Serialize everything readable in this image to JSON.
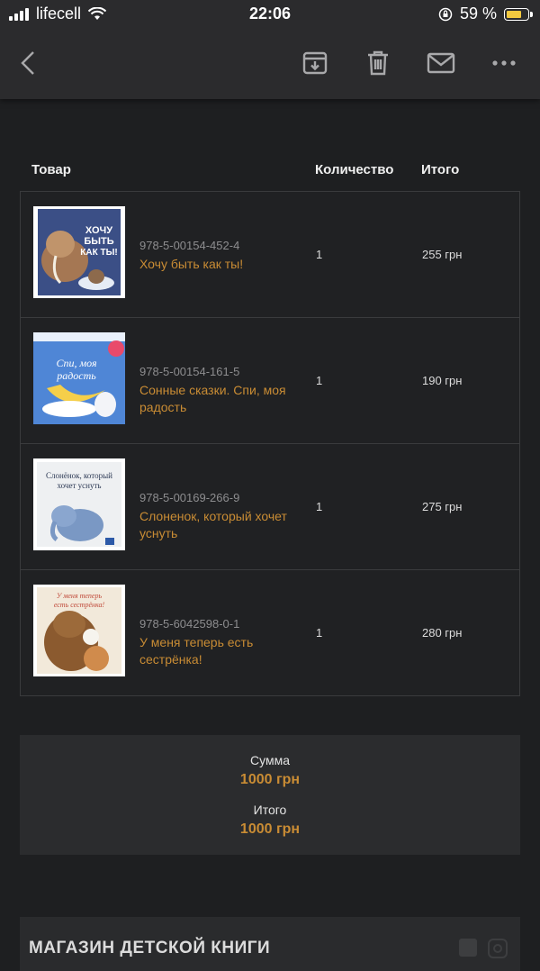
{
  "status_bar": {
    "carrier": "lifecell",
    "time": "22:06",
    "battery": "59 %"
  },
  "toolbar": {
    "icons": [
      "back-icon",
      "archive-icon",
      "trash-icon",
      "mail-icon",
      "more-icon"
    ]
  },
  "table": {
    "headers": {
      "product": "Товар",
      "quantity": "Количество",
      "total": "Итого"
    },
    "rows": [
      {
        "sku": "978-5-00154-452-4",
        "title": "Хочу быть как ты!",
        "quantity": "1",
        "price": "255 грн"
      },
      {
        "sku": "978-5-00154-161-5",
        "title": "Сонные сказки. Спи, моя радость",
        "quantity": "1",
        "price": "190 грн"
      },
      {
        "sku": "978-5-00169-266-9",
        "title": "Слоненок, который хочет уснуть",
        "quantity": "1",
        "price": "275 грн"
      },
      {
        "sku": "978-5-6042598-0-1",
        "title": "У меня теперь есть сестрёнка!",
        "quantity": "1",
        "price": "280 грн"
      }
    ]
  },
  "summary": {
    "sum_label": "Сумма",
    "sum_value": "1000 грн",
    "total_label": "Итого",
    "total_value": "1000 грн"
  },
  "footer": {
    "brand": "МАГАЗИН ДЕТСКОЙ КНИГИ",
    "icons": [
      "facebook-icon",
      "instagram-icon"
    ]
  },
  "colors": {
    "accent": "#c98c34",
    "background": "#1e1f21",
    "toolbar": "#2b2b2d"
  }
}
